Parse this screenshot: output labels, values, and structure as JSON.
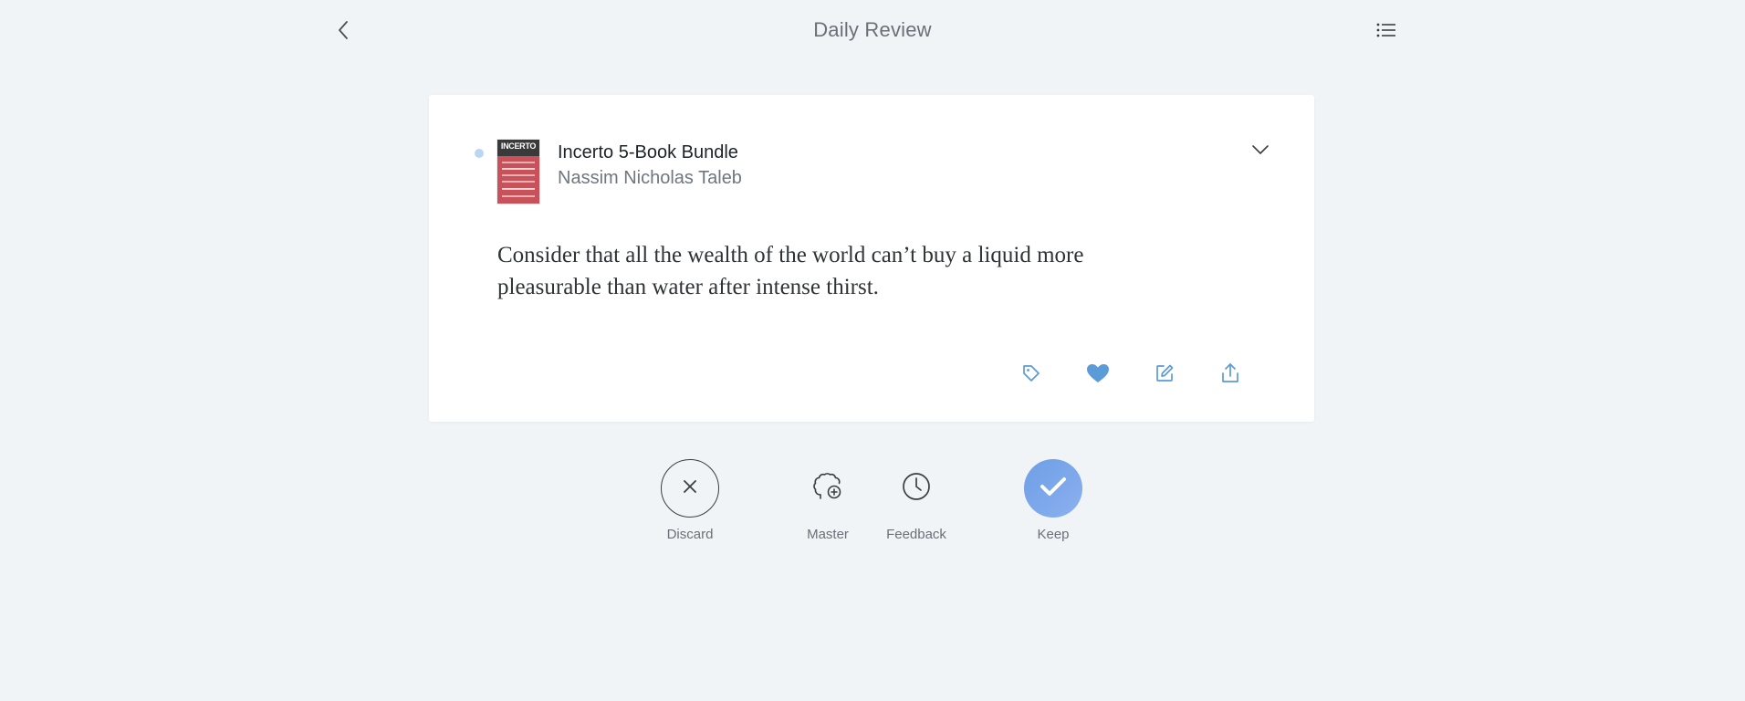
{
  "header": {
    "title": "Daily Review"
  },
  "highlight": {
    "book_title": "Incerto 5-Book Bundle",
    "author": "Nassim Nicholas Taleb",
    "cover_text": "INCERTO",
    "quote": "Consider that all the wealth of the world can’t buy a liquid more pleasurable than water after intense thirst."
  },
  "review_actions": {
    "discard": "Discard",
    "master": "Master",
    "feedback": "Feedback",
    "keep": "Keep"
  },
  "colors": {
    "background": "#f0f4f7",
    "accent": "#6e9fe6",
    "icon_blue": "#5a9bd8",
    "unread_dot": "#b9d7f2"
  },
  "icons": {
    "back": "chevron-left-icon",
    "list": "list-icon",
    "expand": "chevron-down-icon",
    "tag": "tag-icon",
    "favorite": "heart-icon",
    "edit": "edit-icon",
    "share": "share-icon",
    "discard": "close-icon",
    "master": "brain-plus-icon",
    "feedback": "clock-icon",
    "keep": "check-icon"
  }
}
